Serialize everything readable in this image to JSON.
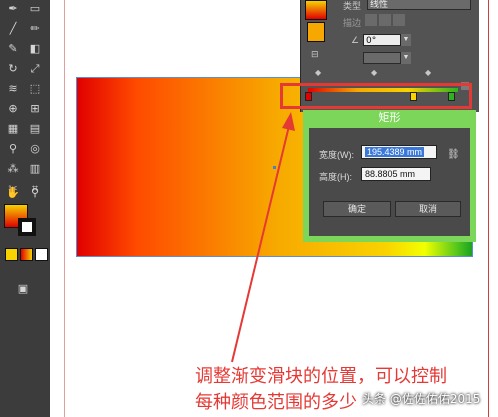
{
  "toolbar": {
    "tools": [
      "pen-icon",
      "rectangle-icon",
      "line-icon",
      "brush-icon",
      "pencil-icon",
      "blob-brush-icon",
      "eraser-icon",
      "rotate-icon",
      "scale-icon",
      "warp-icon",
      "free-transform-icon",
      "shape-builder-icon",
      "perspective-icon",
      "mesh-icon",
      "gradient-icon",
      "eyedropper-icon",
      "blend-icon",
      "symbol-sprayer-icon",
      "graph-icon",
      "artboard-icon",
      "slice-icon",
      "hand-icon",
      "zoom-icon"
    ]
  },
  "gradient_panel": {
    "type_label": "类型",
    "type_value": "线性",
    "stroke_label": "描边",
    "angle_value": "0°"
  },
  "rect_dialog": {
    "title": "矩形",
    "width_label": "宽度(W):",
    "width_value": "195.4389 mm",
    "height_label": "高度(H):",
    "height_value": "88.8805 mm",
    "ok_label": "确定",
    "cancel_label": "取消"
  },
  "annotation": {
    "line1": "调整渐变滑块的位置，可以控制",
    "line2": "每种颜色范围的多少"
  },
  "watermark": "头条 @佐佐佑佑2015",
  "colors": {
    "highlight": "#e53935",
    "dialog_frame": "#7cd65a",
    "gradient_start": "#e10000",
    "gradient_mid": "#f7a800",
    "gradient_end": "#1aa320"
  }
}
